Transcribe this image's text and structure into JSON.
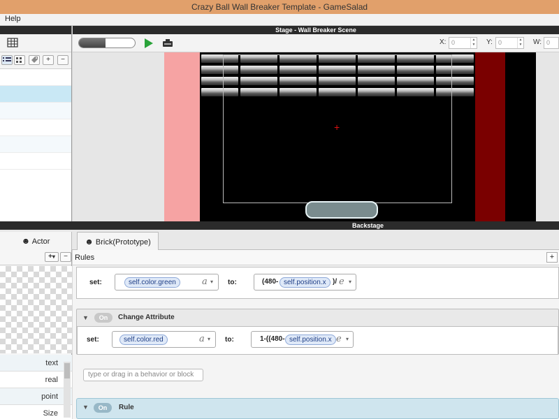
{
  "window": {
    "title": "Crazy Ball Wall Breaker Template - GameSalad"
  },
  "menu": {
    "help": "Help"
  },
  "left_panel": {
    "buttons": [
      "table-icon",
      "list-view-icon",
      "grid-view-icon",
      "tag-icon",
      "plus-icon",
      "minus-icon"
    ],
    "plus": "+",
    "minus": "−"
  },
  "stage": {
    "header": "Stage - Wall Breaker Scene",
    "x_label": "X:",
    "x_value": "0",
    "y_label": "Y:",
    "y_value": "0",
    "w_label": "W:",
    "w_value": "0",
    "zoom_fill": 0.48
  },
  "backstage": {
    "header": "Backstage",
    "tab_actor": "Actor",
    "tab_brick": "Brick(Prototype)"
  },
  "actor_panel": {
    "plus": "+",
    "chevron": "▾",
    "minus": "−",
    "attributes": [
      "text",
      "real",
      "point",
      "Size"
    ]
  },
  "rules": {
    "label": "Rules",
    "add": "+",
    "block1": {
      "set": "set:",
      "target": "self.color.green",
      "to": "to:",
      "expr_prefix": "(480-",
      "expr_attr": "self.position.x",
      "expr_suffix": ")/"
    },
    "block2": {
      "title": "Change Attribute",
      "on": "On",
      "set": "set:",
      "target": "self.color.red",
      "to": "to:",
      "expr_prefix": "1-((480-",
      "expr_attr": "self.position.x"
    },
    "placeholder": "type or drag in a behavior or block",
    "rule": {
      "on": "On",
      "title": "Rule"
    }
  },
  "icons": {
    "a_glyph": "a",
    "e_glyph": "e",
    "dropdown": "▾",
    "collapse": "▼"
  }
}
